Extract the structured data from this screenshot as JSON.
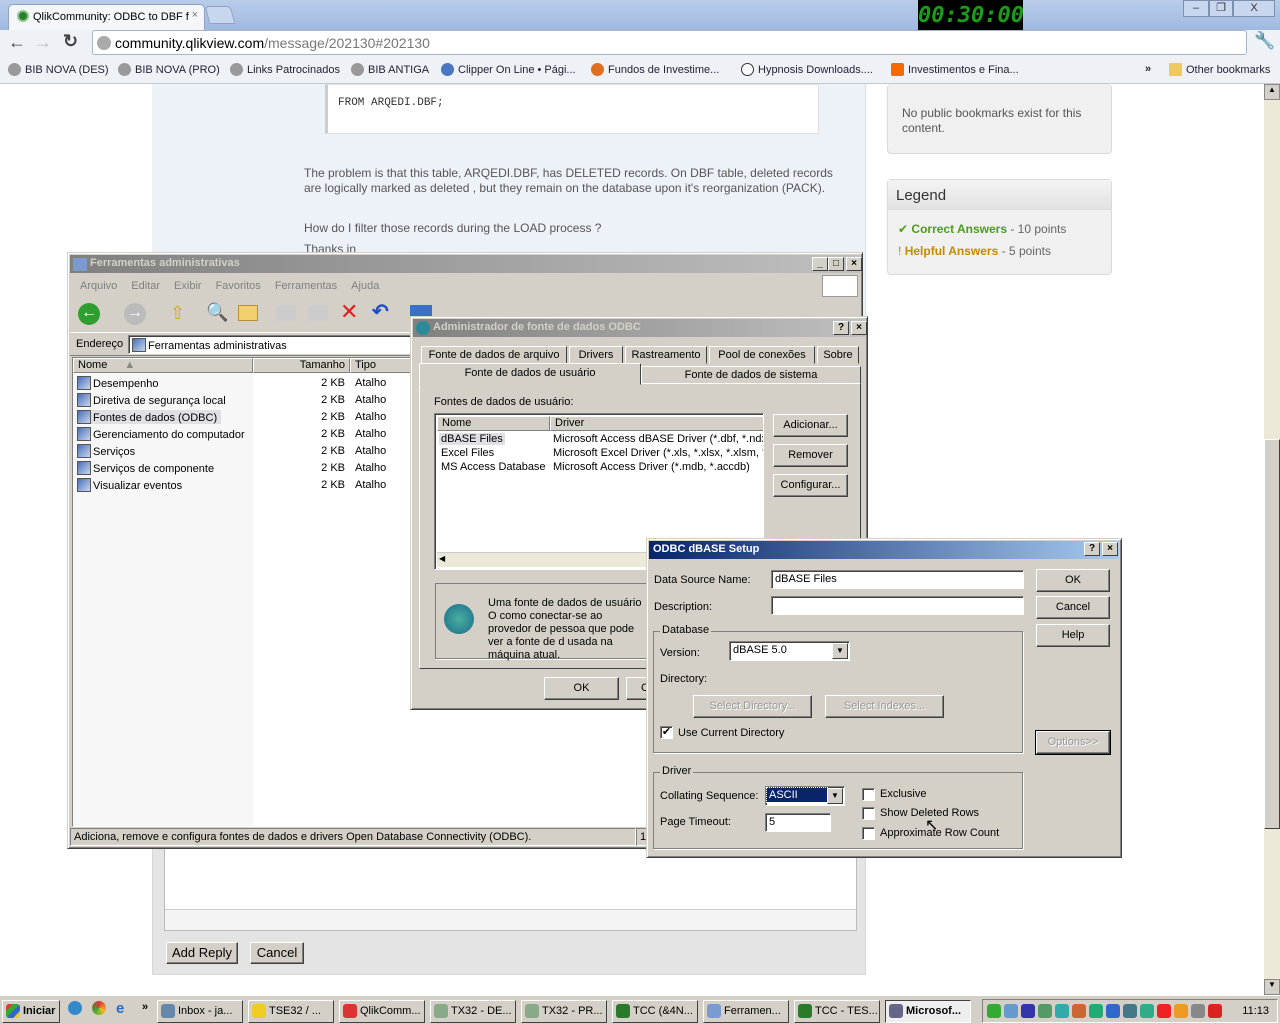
{
  "browser": {
    "tab_title": "QlikCommunity: ODBC to DBF f",
    "url_host": "community.qlikview.com",
    "url_path": "/message/202130#202130",
    "timer": "00:30:00",
    "bookmarks": [
      "BIB NOVA (DES)",
      "BIB NOVA (PRO)",
      "Links Patrocinados",
      "BIB ANTIGA",
      "Clipper On Line • Pági...",
      "Fundos de Investime...",
      "Hypnosis Downloads....",
      "Investimentos e Fina..."
    ],
    "overflow": "»",
    "other_bookmarks": "Other bookmarks"
  },
  "page": {
    "code_line": "FROM ARQEDI.DBF;",
    "para1": "The problem is that this table, ARQEDI.DBF, has DELETED records. On DBF table, deleted records are logically marked as deleted , but they remain on the database upon it's reorganization (PACK).",
    "para2": "How do I filter those records during the LOAD process ?",
    "para3": "Thanks in",
    "bookmarks_note": "No public bookmarks exist for this content.",
    "legend": {
      "title": "Legend",
      "correct": "Correct Answers",
      "correct_pts": " - 10 points",
      "helpful": "Helpful Answers",
      "helpful_pts": " - 5 points",
      "correct_color": "#4a9e1c",
      "helpful_color": "#c68a00"
    },
    "add_reply": "Add Reply",
    "cancel": "Cancel"
  },
  "explorer": {
    "title": "Ferramentas administrativas",
    "menu": [
      "Arquivo",
      "Editar",
      "Exibir",
      "Favoritos",
      "Ferramentas",
      "Ajuda"
    ],
    "address_label": "Endereço",
    "address": "Ferramentas administrativas",
    "columns": [
      "Nome",
      "Tamanho",
      "Tipo"
    ],
    "files": [
      {
        "name": "Desempenho",
        "size": "2 KB",
        "type": "Atalho"
      },
      {
        "name": "Diretiva de segurança local",
        "size": "2 KB",
        "type": "Atalho"
      },
      {
        "name": "Fontes de dados (ODBC)",
        "size": "2 KB",
        "type": "Atalho"
      },
      {
        "name": "Gerenciamento do computador",
        "size": "2 KB",
        "type": "Atalho"
      },
      {
        "name": "Serviços",
        "size": "2 KB",
        "type": "Atalho"
      },
      {
        "name": "Serviços de componente",
        "size": "2 KB",
        "type": "Atalho"
      },
      {
        "name": "Visualizar eventos",
        "size": "2 KB",
        "type": "Atalho"
      }
    ],
    "status": "Adiciona, remove e configura fontes de dados e drivers Open Database Connectivity (ODBC).",
    "status2": "1,"
  },
  "odbc": {
    "title": "Administrador de fonte de dados ODBC",
    "tabs_back": [
      "Fonte de dados de arquivo",
      "Drivers",
      "Rastreamento",
      "Pool de conexões",
      "Sobre"
    ],
    "tab_active": "Fonte de dados de usuário",
    "tab_system": "Fonte de dados de sistema",
    "list_label": "Fontes de dados de usuário:",
    "columns": [
      "Nome",
      "Driver"
    ],
    "sources": [
      {
        "name": "dBASE Files",
        "driver": "Microsoft Access dBASE Driver (*.dbf, *.ndx"
      },
      {
        "name": "Excel Files",
        "driver": "Microsoft Excel Driver (*.xls, *.xlsx, *.xlsm, *.x"
      },
      {
        "name": "MS Access Database",
        "driver": "Microsoft Access Driver (*.mdb, *.accdb)"
      }
    ],
    "buttons": [
      "Adicionar...",
      "Remover",
      "Configurar..."
    ],
    "info": "Uma fonte de dados de usuário O como conectar-se ao provedor de pessoa que pode ver a fonte de d usada na máquina atual.",
    "ok": "OK",
    "cancel_partial": "C"
  },
  "dbase": {
    "title": "ODBC dBASE Setup",
    "dsn_label": "Data Source Name:",
    "dsn": "dBASE Files",
    "desc_label": "Description:",
    "desc": "",
    "ok": "OK",
    "cancel": "Cancel",
    "help": "Help",
    "options": "Options>>",
    "database_group": "Database",
    "version_label": "Version:",
    "version": "dBASE 5.0",
    "directory_label": "Directory:",
    "select_dir": "Select Directory...",
    "select_idx": "Select Indexes...",
    "use_current": "Use Current Directory",
    "use_current_checked": true,
    "driver_group": "Driver",
    "collating_label": "Collating Sequence:",
    "collating": "ASCII",
    "timeout_label": "Page Timeout:",
    "timeout": "5",
    "exclusive": "Exclusive",
    "show_deleted": "Show Deleted Rows",
    "approx": "Approximate Row Count"
  },
  "taskbar": {
    "start": "Iniciar",
    "overflow": "»",
    "items": [
      "Inbox - ja...",
      "TSE32  / ...",
      "QlikComm...",
      "TX32 - DE...",
      "TX32 - PR...",
      "TCC (&4N...",
      "Ferramen...",
      "TCC - TES...",
      "Microsof..."
    ],
    "clock": "11:13"
  }
}
